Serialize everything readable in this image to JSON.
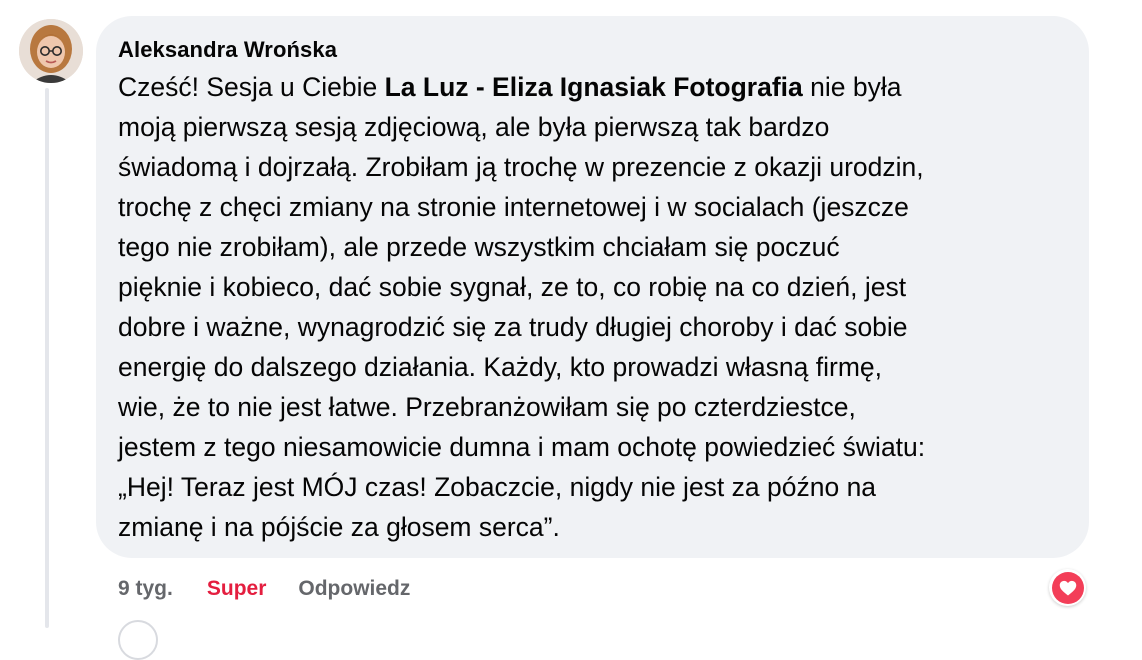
{
  "comment": {
    "author": "Aleksandra Wrońska",
    "text_before": "Cześć! Sesja u Ciebie ",
    "mentioned_page": "La Luz - Eliza Ignasiak Fotografia",
    "text_after": " nie była\nmoją pierwszą sesją zdjęciową, ale była pierwszą tak bardzo\nświadomą i dojrzałą. Zrobiłam ją trochę w prezencie z okazji urodzin,\ntrochę z chęci zmiany na stronie internetowej i w socialach (jeszcze\ntego nie zrobiłam), ale przede wszystkim chciałam się poczuć\npięknie i kobieco, dać sobie sygnał, ze to, co robię na co dzień, jest\ndobre i ważne, wynagrodzić się za trudy długiej choroby i dać sobie\nenergię do dalszego działania. Każdy, kto prowadzi własną firmę,\nwie, że to nie jest łatwe. Przebranżowiłam się po czterdziestce,\njestem z tego niesamowicie dumna i mam ochotę powiedzieć światu:\n„Hej! Teraz jest MÓJ czas! Zobaczcie, nigdy nie jest za późno na\nzmianę i na pójście za głosem serca”."
  },
  "actions": {
    "time": "9 tyg.",
    "reaction_label": "Super",
    "reply_label": "Odpowiedz"
  },
  "reaction_badge": {
    "icon": "heart-icon",
    "color": "#f33e58"
  },
  "colors": {
    "bubble_bg": "#f0f2f5",
    "meta_text": "#65676b",
    "reaction_text": "#e41e3f"
  }
}
